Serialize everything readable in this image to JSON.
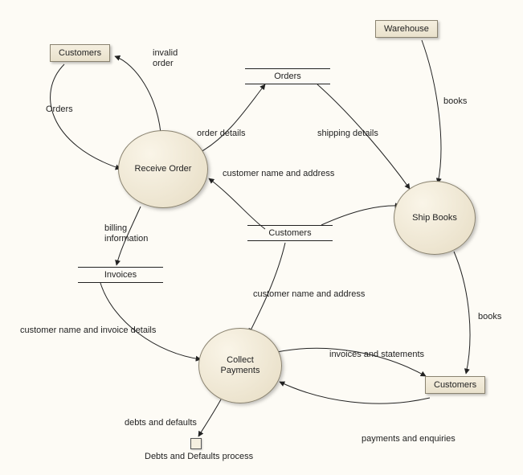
{
  "entities": {
    "customers1": "Customers",
    "warehouse": "Warehouse",
    "customers2": "Customers"
  },
  "processes": {
    "receive_order": "Receive Order",
    "ship_books": "Ship Books",
    "collect_payments": "Collect\nPayments"
  },
  "datastores": {
    "orders": "Orders",
    "customers": "Customers",
    "invoices": "Invoices"
  },
  "offpage": {
    "debts": "Debts and Defaults process"
  },
  "flows": {
    "invalid_order": "invalid\norder",
    "orders_in": "Orders",
    "books_wh": "books",
    "order_details": "order details",
    "shipping_details": "shipping details",
    "cust_name_addr1": "customer name and address",
    "billing_info": "billing\ninformation",
    "cust_name_addr2": "customer name and address",
    "cust_name_invoice": "customer name and invoice details",
    "invoices_statements": "invoices and statements",
    "books_out": "books",
    "debts_defaults": "debts and defaults",
    "payments_enq": "payments and enquiries"
  }
}
